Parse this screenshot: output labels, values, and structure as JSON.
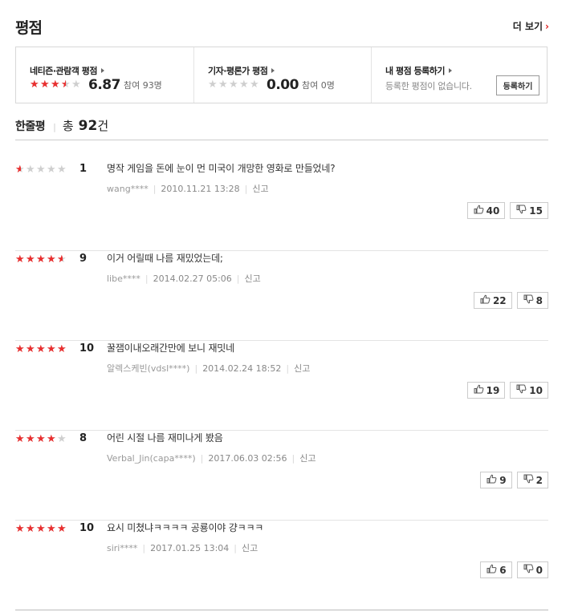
{
  "header": {
    "title": "평점",
    "more_label": "더 보기",
    "more_arrow": "›"
  },
  "rating_box": {
    "netizen": {
      "label": "네티즌·관람객 평점",
      "rating": 6.87,
      "score": "6.87",
      "participants": "참여 93명"
    },
    "critic": {
      "label": "기자·평론가 평점",
      "rating": 0,
      "score": "0.00",
      "participants": "참여 0명"
    },
    "mine": {
      "label": "내 평점 등록하기",
      "desc": "등록한 평점이 없습니다.",
      "button": "등록하기"
    }
  },
  "summary": {
    "title": "한줄평",
    "total_label": "총",
    "count": "92",
    "unit": "건"
  },
  "reviews": [
    {
      "rating": 1,
      "score": "1",
      "text": "명작 게임을 돈에 눈이 먼 미국이 개망한 영화로 만들었네?",
      "user": "wang****",
      "date": "2010.11.21 13:28",
      "report": "신고",
      "likes": "40",
      "dislikes": "15"
    },
    {
      "rating": 9,
      "score": "9",
      "text": "이거 어릴때 나름 재밌었는데;",
      "user": "libe****",
      "date": "2014.02.27 05:06",
      "report": "신고",
      "likes": "22",
      "dislikes": "8"
    },
    {
      "rating": 10,
      "score": "10",
      "text": "꿀잼이내오래간만에 보니 재밋네",
      "user": "알렉스케빈(vdsl****)",
      "date": "2014.02.24 18:52",
      "report": "신고",
      "likes": "19",
      "dislikes": "10"
    },
    {
      "rating": 8,
      "score": "8",
      "text": "어린 시절 나름 재미나게 봤음",
      "user": "Verbal_Jin(capa****)",
      "date": "2017.06.03 02:56",
      "report": "신고",
      "likes": "9",
      "dislikes": "2"
    },
    {
      "rating": 10,
      "score": "10",
      "text": "요시 미쳤냐ㅋㅋㅋㅋ 공룡이야 걍ㅋㅋㅋ",
      "user": "siri****",
      "date": "2017.01.25 13:04",
      "report": "신고",
      "likes": "6",
      "dislikes": "0"
    }
  ],
  "colors": {
    "star_on": "#ea2f2f",
    "star_off": "#cfcfcf",
    "accent": "#e02020"
  },
  "icons": {
    "like": "thumbs-up-icon",
    "dislike": "thumbs-down-icon",
    "star": "star-icon"
  }
}
